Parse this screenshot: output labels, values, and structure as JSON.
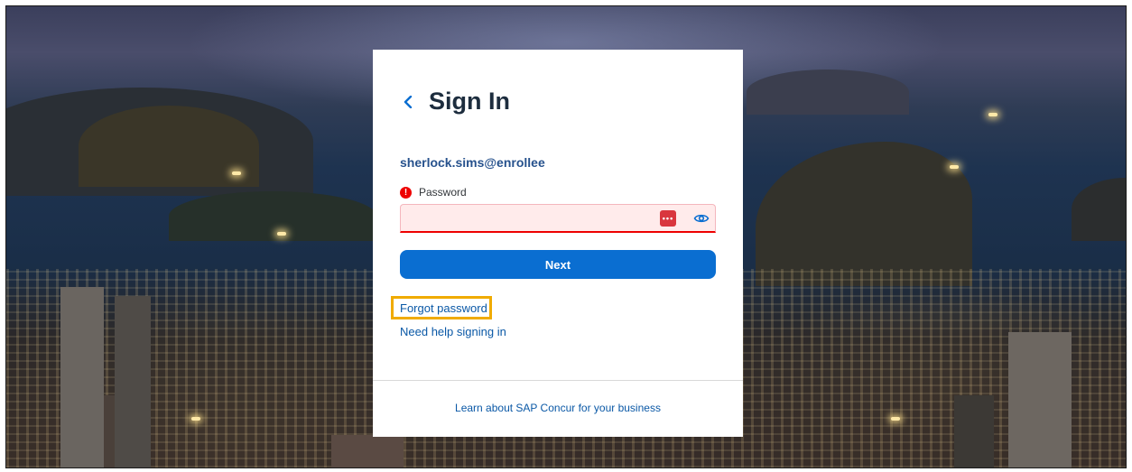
{
  "signin": {
    "title": "Sign In",
    "username": "sherlock.sims@enrollee",
    "password": {
      "label": "Password",
      "value": "",
      "error_icon": "error-icon",
      "manager_icon_glyph": "•••"
    },
    "next_label": "Next",
    "links": {
      "forgot_password": "Forgot password",
      "need_help": "Need help signing in"
    },
    "footer_link": "Learn about SAP Concur for your business"
  },
  "icons": {
    "back": "chevron-left-icon",
    "error": "exclamation-circle-icon",
    "password_manager": "password-manager-icon",
    "show_password": "eye-icon"
  },
  "colors": {
    "accent": "#0a6ed1",
    "error": "#e00000",
    "field_error_bg": "#ffebeb",
    "highlight": "#f0ab00",
    "title": "#1d2d3e",
    "username": "#27528d"
  }
}
